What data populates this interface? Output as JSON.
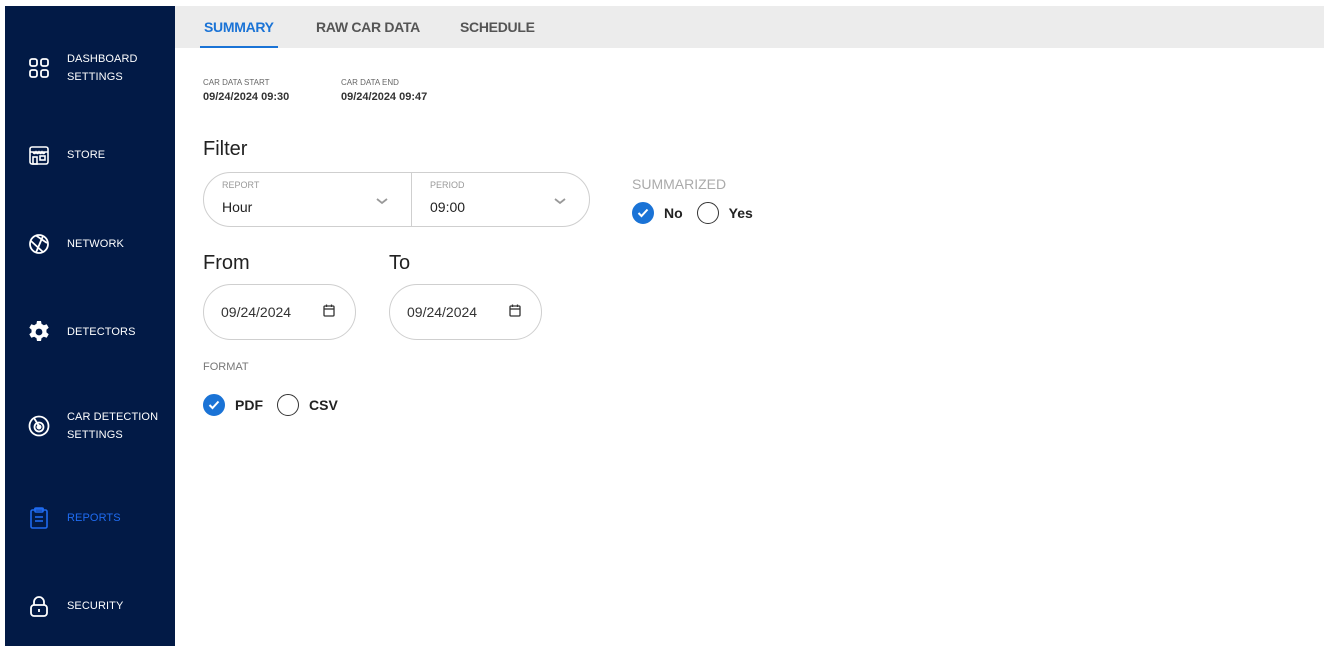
{
  "sidebar": {
    "items": [
      {
        "label": "DASHBOARD\nSETTINGS",
        "icon": "grid-icon",
        "active": false
      },
      {
        "label": "STORE",
        "icon": "store-icon",
        "active": false
      },
      {
        "label": "NETWORK",
        "icon": "network-icon",
        "active": false
      },
      {
        "label": "DETECTORS",
        "icon": "gear-icon",
        "active": false
      },
      {
        "label": "CAR DETECTION\nSETTINGS",
        "icon": "radar-icon",
        "active": false
      },
      {
        "label": "REPORTS",
        "icon": "clipboard-icon",
        "active": true
      },
      {
        "label": "SECURITY",
        "icon": "lock-icon",
        "active": false
      }
    ]
  },
  "tabs": [
    {
      "label": "SUMMARY",
      "active": true
    },
    {
      "label": "RAW CAR DATA",
      "active": false
    },
    {
      "label": "SCHEDULE",
      "active": false
    }
  ],
  "car_data": {
    "start_label": "CAR DATA START",
    "start_value": "09/24/2024 09:30",
    "end_label": "CAR DATA END",
    "end_value": "09/24/2024 09:47"
  },
  "filter": {
    "title": "Filter",
    "report_label": "REPORT",
    "report_value": "Hour",
    "period_label": "PERIOD",
    "period_value": "09:00",
    "summarized_label": "SUMMARIZED",
    "summarized_options": [
      {
        "label": "No",
        "checked": true
      },
      {
        "label": "Yes",
        "checked": false
      }
    ]
  },
  "range": {
    "from_label": "From",
    "from_value": "09/24/2024",
    "to_label": "To",
    "to_value": "09/24/2024"
  },
  "format": {
    "label": "FORMAT",
    "options": [
      {
        "label": "PDF",
        "checked": true
      },
      {
        "label": "CSV",
        "checked": false
      }
    ]
  },
  "colors": {
    "sidebar_bg": "#021a46",
    "accent": "#1a73d6",
    "active_nav": "#1f6bf0"
  }
}
